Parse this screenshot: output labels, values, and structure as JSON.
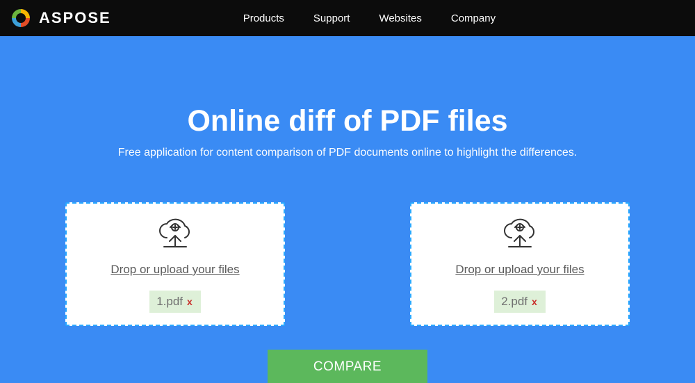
{
  "brand": {
    "name": "ASPOSE"
  },
  "nav": {
    "links": [
      {
        "label": "Products"
      },
      {
        "label": "Support"
      },
      {
        "label": "Websites"
      },
      {
        "label": "Company"
      }
    ]
  },
  "hero": {
    "title": "Online diff of PDF files",
    "subtitle": "Free application for content comparison of PDF documents online to highlight the differences."
  },
  "dropzones": {
    "label": "Drop or upload your files",
    "files": [
      {
        "name": "1.pdf"
      },
      {
        "name": "2.pdf"
      }
    ]
  },
  "actions": {
    "compare_label": "COMPARE"
  },
  "icons": {
    "brand": "swirl-logo-icon",
    "upload": "cloud-upload-icon",
    "remove": "close-icon"
  },
  "colors": {
    "accent_blue": "#3a8bf4",
    "nav_bg": "#0c0c0c",
    "compare_green": "#5cb85c",
    "chip_green": "#def0d8",
    "dashed_border": "#2aa8ff"
  }
}
